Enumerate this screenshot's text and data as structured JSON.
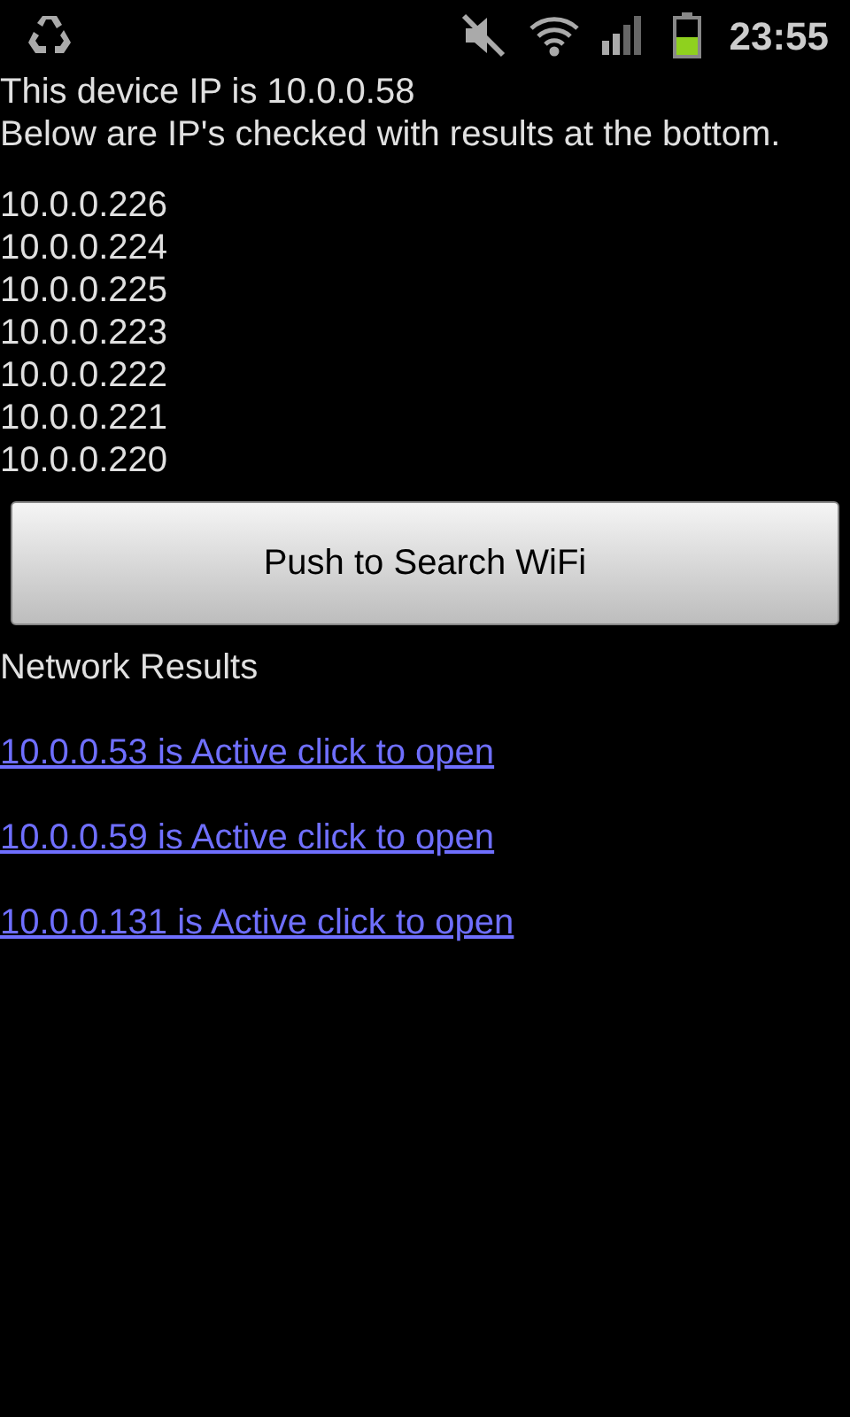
{
  "status_bar": {
    "time": "23:55"
  },
  "device_ip": "This device IP is 10.0.0.58",
  "description": "Below are IP's checked with results at the bottom.",
  "checked_ips": [
    "10.0.0.226",
    "10.0.0.224",
    "10.0.0.225",
    "10.0.0.223",
    "10.0.0.222",
    "10.0.0.221",
    "10.0.0.220"
  ],
  "search_button": "Push to Search WiFi",
  "results_heading": "Network Results",
  "results": [
    "10.0.0.53 is Active click to open",
    "10.0.0.59 is Active click to open",
    "10.0.0.131 is Active click to open"
  ]
}
